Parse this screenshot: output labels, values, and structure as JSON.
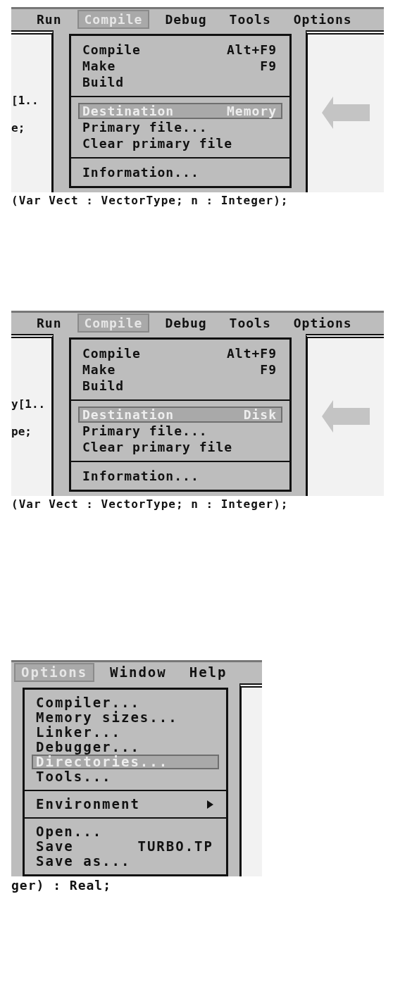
{
  "screens": [
    {
      "menu_bar": [
        {
          "label": "Run",
          "selected": false
        },
        {
          "label": "Compile",
          "selected": true
        },
        {
          "label": "Debug",
          "selected": false
        },
        {
          "label": "Tools",
          "selected": false
        },
        {
          "label": "Options",
          "selected": false
        }
      ],
      "editor_left": [
        "[1..",
        "e;"
      ],
      "menu": {
        "groups": [
          [
            {
              "label": "Compile",
              "shortcut": "Alt+F9",
              "selected": false
            },
            {
              "label": "Make",
              "shortcut": "F9",
              "selected": false
            },
            {
              "label": "Build",
              "selected": false
            }
          ],
          [
            {
              "label": "Destination",
              "shortcut": "Memory",
              "selected": true
            },
            {
              "label": "Primary file...",
              "selected": false
            },
            {
              "label": "Clear primary file",
              "selected": false
            }
          ],
          [
            {
              "label": "Information...",
              "selected": false
            }
          ]
        ]
      },
      "pointer_arrow": true,
      "code_line": "(Var Vect : VectorType; n : Integer);"
    },
    {
      "menu_bar": [
        {
          "label": "Run",
          "selected": false
        },
        {
          "label": "Compile",
          "selected": true
        },
        {
          "label": "Debug",
          "selected": false
        },
        {
          "label": "Tools",
          "selected": false
        },
        {
          "label": "Options",
          "selected": false
        }
      ],
      "editor_left": [
        "y[1..",
        "pe;"
      ],
      "menu": {
        "groups": [
          [
            {
              "label": "Compile",
              "shortcut": "Alt+F9",
              "selected": false
            },
            {
              "label": "Make",
              "shortcut": "F9",
              "selected": false
            },
            {
              "label": "Build",
              "selected": false
            }
          ],
          [
            {
              "label": "Destination",
              "shortcut": "Disk",
              "selected": true
            },
            {
              "label": "Primary file...",
              "selected": false
            },
            {
              "label": "Clear primary file",
              "selected": false
            }
          ],
          [
            {
              "label": "Information...",
              "selected": false
            }
          ]
        ]
      },
      "pointer_arrow": true,
      "code_line": "(Var Vect : VectorType; n : Integer);"
    },
    {
      "menu_bar": [
        {
          "label": "Options",
          "selected": true
        },
        {
          "label": "Window",
          "selected": false
        },
        {
          "label": "Help",
          "selected": false
        }
      ],
      "menu": {
        "groups": [
          [
            {
              "label": "Compiler...",
              "selected": false
            },
            {
              "label": "Memory sizes...",
              "selected": false
            },
            {
              "label": "Linker...",
              "selected": false
            },
            {
              "label": "Debugger...",
              "selected": false
            },
            {
              "label": "Directories...",
              "selected": true
            },
            {
              "label": "Tools...",
              "selected": false
            }
          ],
          [
            {
              "label": "Environment",
              "submenu": true,
              "selected": false
            }
          ],
          [
            {
              "label": "Open...",
              "selected": false
            },
            {
              "label": "Save",
              "shortcut": "TURBO.TP",
              "selected": false
            },
            {
              "label": "Save as...",
              "selected": false
            }
          ]
        ]
      },
      "code_line": "ger) : Real;"
    }
  ]
}
